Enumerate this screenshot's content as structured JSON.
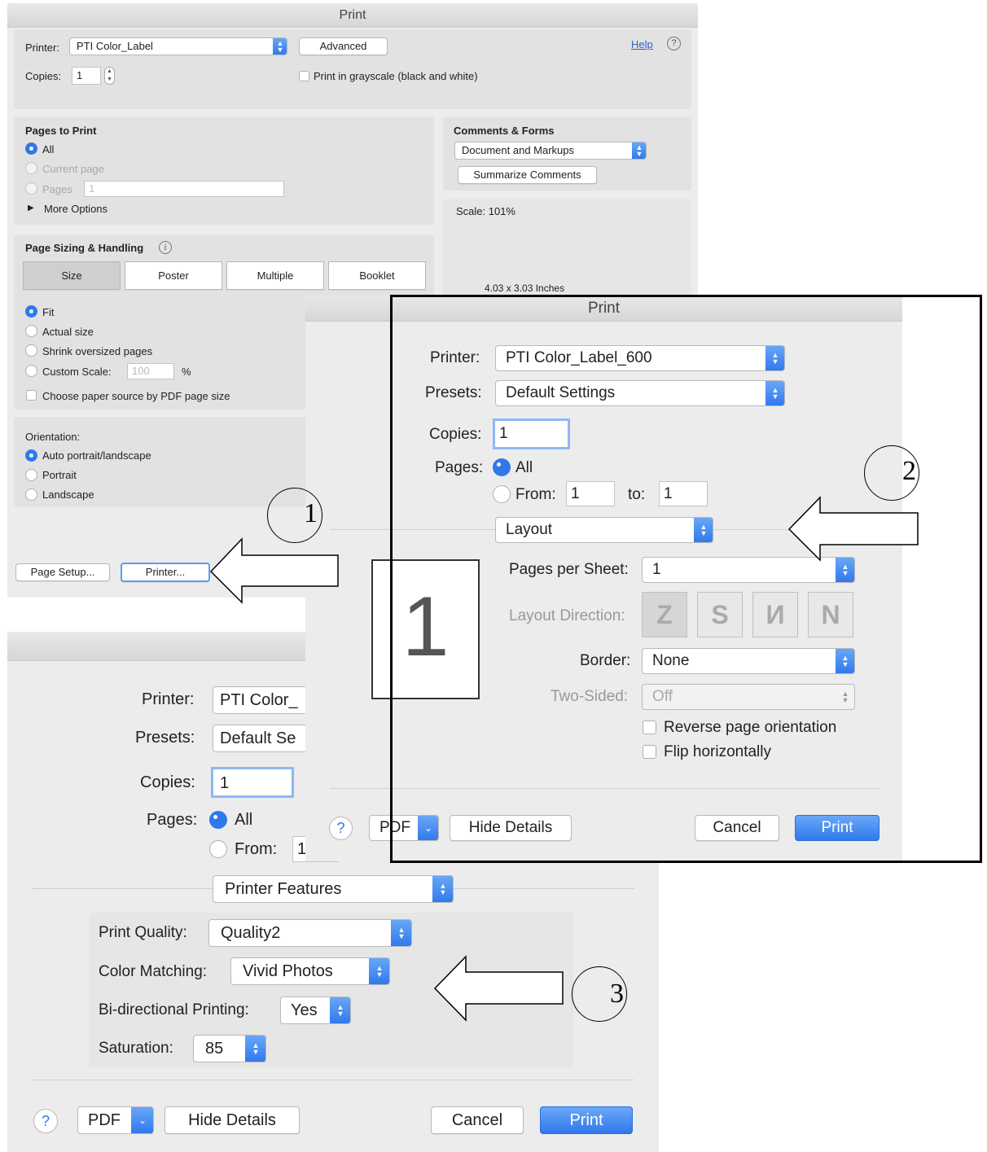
{
  "acrobat": {
    "title": "Print",
    "printer_label": "Printer:",
    "printer_value": "PTI Color_Label",
    "advanced_label": "Advanced",
    "help_label": "Help",
    "help_icon": "?",
    "copies_label": "Copies:",
    "copies_value": "1",
    "grayscale_label": "Print in grayscale (black and white)",
    "pages_to_print": {
      "heading": "Pages to Print",
      "all": "All",
      "current_page": "Current page",
      "pages": "Pages",
      "pages_value": "1",
      "more_options": "More Options"
    },
    "comments_forms": {
      "heading": "Comments & Forms",
      "value": "Document and Markups",
      "summarize": "Summarize Comments"
    },
    "scale_label": "Scale: 101%",
    "dimensions": "4.03 x 3.03 Inches",
    "page_sizing": {
      "heading": "Page Sizing & Handling",
      "tabs": [
        "Size",
        "Poster",
        "Multiple",
        "Booklet"
      ],
      "fit": "Fit",
      "actual_size": "Actual size",
      "shrink": "Shrink oversized pages",
      "custom_scale": "Custom Scale:",
      "custom_value": "100",
      "percent": "%",
      "paper_source": "Choose paper source by PDF page size"
    },
    "orientation": {
      "heading": "Orientation:",
      "auto": "Auto portrait/landscape",
      "portrait": "Portrait",
      "landscape": "Landscape"
    },
    "page_setup": "Page Setup...",
    "printer_btn": "Printer..."
  },
  "mac_layout": {
    "title": "Print",
    "printer_label": "Printer:",
    "printer_value": "PTI Color_Label_600",
    "presets_label": "Presets:",
    "presets_value": "Default Settings",
    "copies_label": "Copies:",
    "copies_value": "1",
    "pages_label": "Pages:",
    "all": "All",
    "from_label": "From:",
    "from_value": "1",
    "to_label": "to:",
    "to_value": "1",
    "section_value": "Layout",
    "preview_page": "1",
    "pages_per_sheet_label": "Pages per Sheet:",
    "pages_per_sheet_value": "1",
    "layout_direction_label": "Layout Direction:",
    "border_label": "Border:",
    "border_value": "None",
    "two_sided_label": "Two-Sided:",
    "two_sided_value": "Off",
    "reverse_label": "Reverse page orientation",
    "flip_label": "Flip horizontally",
    "help_icon": "?",
    "pdf_label": "PDF",
    "hide_details": "Hide Details",
    "cancel": "Cancel",
    "print": "Print"
  },
  "mac_features": {
    "printer_label": "Printer:",
    "printer_value": "PTI Color_",
    "presets_label": "Presets:",
    "presets_value": "Default Se",
    "copies_label": "Copies:",
    "copies_value": "1",
    "pages_label": "Pages:",
    "all": "All",
    "from_label": "From:",
    "from_value": "1",
    "section_value": "Printer Features",
    "print_quality_label": "Print Quality:",
    "print_quality_value": "Quality2",
    "color_matching_label": "Color Matching:",
    "color_matching_value": "Vivid Photos",
    "bidirectional_label": "Bi-directional Printing:",
    "bidirectional_value": "Yes",
    "saturation_label": "Saturation:",
    "saturation_value": "85",
    "help_icon": "?",
    "pdf_label": "PDF",
    "hide_details": "Hide Details",
    "cancel": "Cancel",
    "print": "Print"
  },
  "annotations": {
    "step1": "1",
    "step2": "2",
    "step3": "3"
  },
  "colors": {
    "accent_blue": "#2f78ec",
    "dialog_bg": "#ececec",
    "panel_bg": "#e2e2e2"
  }
}
